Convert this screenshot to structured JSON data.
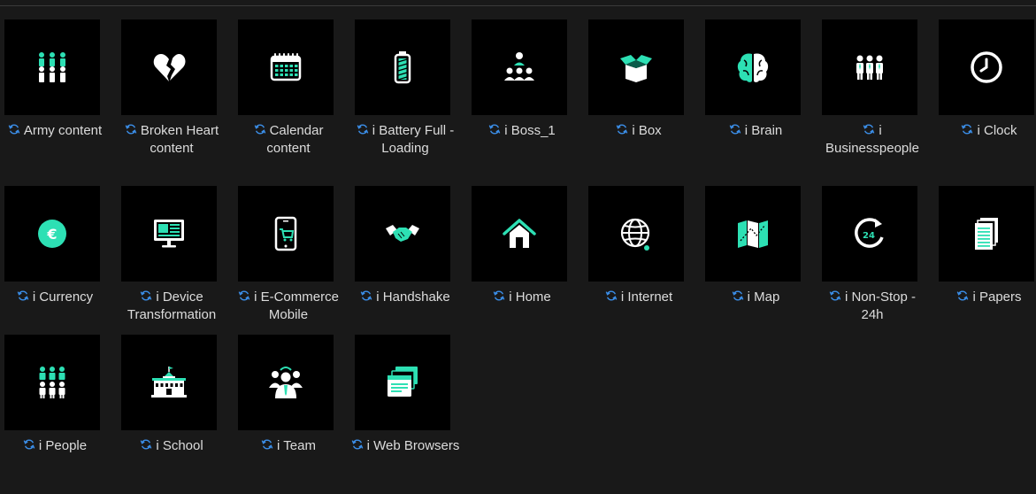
{
  "colors": {
    "background": "#191919",
    "thumbnail": "#000000",
    "accent": "#2de0b4",
    "icon_white": "#ffffff",
    "sync_blue": "#3b8ee8",
    "label_text": "#dcdcdc"
  },
  "items": [
    {
      "label": "Army content",
      "icon": "army-icon"
    },
    {
      "label": "Broken Heart content",
      "icon": "broken-heart-icon"
    },
    {
      "label": "Calendar content",
      "icon": "calendar-icon"
    },
    {
      "label": "i Battery Full - Loading",
      "icon": "battery-icon"
    },
    {
      "label": "i Boss_1",
      "icon": "boss-icon"
    },
    {
      "label": "i Box",
      "icon": "box-icon"
    },
    {
      "label": "i Brain",
      "icon": "brain-icon"
    },
    {
      "label": "i Businesspeople",
      "icon": "businesspeople-icon"
    },
    {
      "label": "i Clock",
      "icon": "clock-icon"
    },
    {
      "label": "i Currency",
      "icon": "currency-icon"
    },
    {
      "label": "i Device Transformation",
      "icon": "device-transformation-icon"
    },
    {
      "label": "i E-Commerce Mobile",
      "icon": "ecommerce-mobile-icon"
    },
    {
      "label": "i Handshake",
      "icon": "handshake-icon"
    },
    {
      "label": "i Home",
      "icon": "home-icon"
    },
    {
      "label": "i Internet",
      "icon": "internet-icon"
    },
    {
      "label": "i Map",
      "icon": "map-icon"
    },
    {
      "label": "i Non-Stop - 24h",
      "icon": "non-stop-24h-icon"
    },
    {
      "label": "i Papers",
      "icon": "papers-icon"
    },
    {
      "label": "i People",
      "icon": "people-icon"
    },
    {
      "label": "i School",
      "icon": "school-icon"
    },
    {
      "label": "i Team",
      "icon": "team-icon"
    },
    {
      "label": "i Web Browsers",
      "icon": "web-browsers-icon"
    }
  ]
}
